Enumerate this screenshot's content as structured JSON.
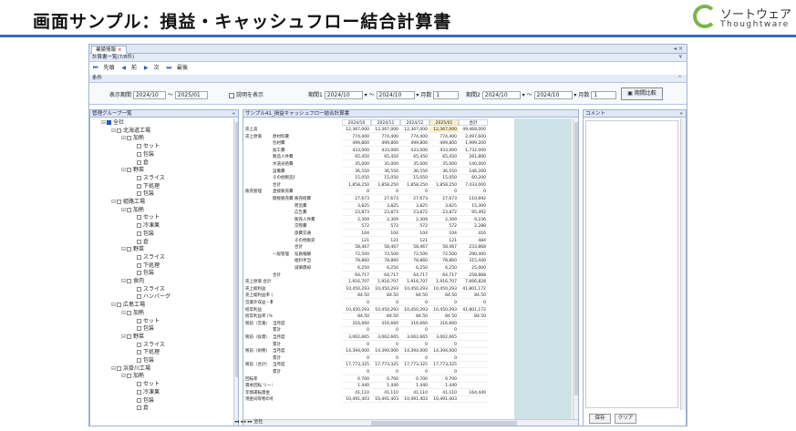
{
  "slide": {
    "title": "画面サンプル：損益・キャッシュフロー結合計算書",
    "logo_jp": "ソートウェア",
    "logo_en": "Thoughtware"
  },
  "app": {
    "tab_label": "業績情報",
    "list_bar": "計算書一覧(7/8件)",
    "pager": {
      "first": "先頭",
      "prev": "前",
      "next": "次",
      "last": "最後"
    },
    "condition_bar": "条件",
    "filter": {
      "period_label": "表示期間",
      "period_from": "2024/10",
      "tilde": "～",
      "period_to": "2025/01",
      "show_desc_label": "説明を表示",
      "p1_label": "期間1",
      "p1_from": "2024/10",
      "p1_to": "2024/10",
      "p1_months_label": "月数",
      "p1_months": "1",
      "p2_label": "期間2",
      "p2_from": "2024/10",
      "p2_to": "2024/10",
      "p2_months_label": "月数",
      "p2_months": "1",
      "compare_button": "期間比較"
    },
    "left_panel_title": "管理グループ一覧",
    "center_panel_title": "サンプル41_損益キャッシュフロー結合計算書",
    "right_panel_title": "コメント",
    "save_button": "保存",
    "clear_button": "クリア",
    "sheet_tab": "全社"
  },
  "tree": [
    {
      "label": "全社",
      "level": 0,
      "checked": true
    },
    {
      "label": "北海道工場",
      "level": 1
    },
    {
      "label": "加熱",
      "level": 2
    },
    {
      "label": "セット",
      "level": 3
    },
    {
      "label": "包装",
      "level": 3
    },
    {
      "label": "倉",
      "level": 3
    },
    {
      "label": "野菜",
      "level": 2
    },
    {
      "label": "スライス",
      "level": 3
    },
    {
      "label": "下処理",
      "level": 3
    },
    {
      "label": "包装",
      "level": 3
    },
    {
      "label": "姫路工場",
      "level": 1
    },
    {
      "label": "加熱",
      "level": 2
    },
    {
      "label": "セット",
      "level": 3
    },
    {
      "label": "冷凍果",
      "level": 3
    },
    {
      "label": "包装",
      "level": 3
    },
    {
      "label": "倉",
      "level": 3
    },
    {
      "label": "野菜",
      "level": 2
    },
    {
      "label": "スライス",
      "level": 3
    },
    {
      "label": "下処理",
      "level": 3
    },
    {
      "label": "包装",
      "level": 3
    },
    {
      "label": "食肉",
      "level": 2
    },
    {
      "label": "スライス",
      "level": 3
    },
    {
      "label": "ハンバーグ",
      "level": 3
    },
    {
      "label": "広島工場",
      "level": 1
    },
    {
      "label": "加熱",
      "level": 2
    },
    {
      "label": "セット",
      "level": 3
    },
    {
      "label": "包装",
      "level": 3
    },
    {
      "label": "野菜",
      "level": 2
    },
    {
      "label": "スライス",
      "level": 3
    },
    {
      "label": "下処理",
      "level": 3
    },
    {
      "label": "包装",
      "level": 3
    },
    {
      "label": "浜掛川工場",
      "level": 1
    },
    {
      "label": "加熱",
      "level": 2
    },
    {
      "label": "セット",
      "level": 3
    },
    {
      "label": "冷凍果",
      "level": 3
    },
    {
      "label": "包装",
      "level": 3
    },
    {
      "label": "倉",
      "level": 3
    }
  ],
  "table": {
    "columns": [
      "2024/10",
      "2024/11",
      "2024/12",
      "2025/01",
      "合計"
    ],
    "highlight_col": 3,
    "rows": [
      [
        "売上高",
        "",
        "",
        "12,367,000",
        "12,367,000",
        "12,367,000",
        "12,367,000",
        "49,468,000"
      ],
      [
        "売上原価",
        "原材料費",
        "",
        "774,400",
        "774,400",
        "774,400",
        "774,400",
        "2,097,600"
      ],
      [
        "",
        "包材費",
        "",
        "499,800",
        "499,800",
        "499,800",
        "499,800",
        "1,999,200"
      ],
      [
        "",
        "加工費",
        "",
        "433,000",
        "433,000",
        "433,000",
        "433,000",
        "1,732,000"
      ],
      [
        "",
        "製造人件費",
        "",
        "65,450",
        "65,450",
        "65,450",
        "65,450",
        "261,800"
      ],
      [
        "",
        "水道光熱費",
        "",
        "35,000",
        "35,000",
        "35,000",
        "35,000",
        "140,000"
      ],
      [
        "",
        "設備費",
        "",
        "36,550",
        "36,550",
        "36,550",
        "36,550",
        "146,200"
      ],
      [
        "",
        "その他製造費",
        "",
        "15,050",
        "15,050",
        "15,050",
        "15,050",
        "60,200"
      ],
      [
        "",
        "合計",
        "",
        "1,858,250",
        "1,858,250",
        "1,858,250",
        "1,858,250",
        "7,433,000"
      ],
      [
        "販売管理",
        "直接販売費",
        "",
        "0",
        "0",
        "0",
        "0",
        "0"
      ],
      [
        "",
        "間接販売費",
        "販売経費",
        "27,673",
        "27,673",
        "27,673",
        "27,673",
        "110,692"
      ],
      [
        "",
        "",
        "荷造費",
        "3,825",
        "3,825",
        "3,825",
        "3,825",
        "15,300"
      ],
      [
        "",
        "",
        "広告費",
        "23,873",
        "23,873",
        "23,872",
        "23,872",
        "95,492"
      ],
      [
        "",
        "",
        "販売人件費",
        "2,309",
        "2,309",
        "2,309",
        "2,309",
        "9,236"
      ],
      [
        "",
        "",
        "交際費",
        "572",
        "572",
        "572",
        "572",
        "2,288"
      ],
      [
        "",
        "",
        "旅費交通",
        "104",
        "104",
        "104",
        "104",
        "416"
      ],
      [
        "",
        "",
        "その他販売費",
        "121",
        "121",
        "121",
        "121",
        "484"
      ],
      [
        "",
        "",
        "合計",
        "58,467",
        "58,467",
        "58,467",
        "58,467",
        "233,868"
      ],
      [
        "",
        "一般管理",
        "役員報酬",
        "72,500",
        "72,500",
        "72,500",
        "72,500",
        "290,400"
      ],
      [
        "",
        "",
        "給料手当",
        "78,860",
        "78,860",
        "78,860",
        "78,860",
        "315,440"
      ],
      [
        "",
        "",
        "減価償却",
        "6,250",
        "6,250",
        "6,250",
        "6,250",
        "25,000"
      ],
      [
        "",
        "合計",
        "",
        "64,717",
        "64,717",
        "64,717",
        "64,717",
        "258,868"
      ],
      [
        "売上原価 合計",
        "",
        "",
        "1,916,707",
        "1,916,707",
        "1,916,707",
        "1,916,707",
        "7,666,828"
      ],
      [
        "売上総利益",
        "",
        "",
        "10,450,293",
        "10,450,293",
        "10,450,293",
        "10,450,293",
        "41,801,172"
      ],
      [
        "売上総利益率 (%)",
        "",
        "",
        "84.50",
        "84.50",
        "84.50",
        "84.50",
        "84.50"
      ],
      [
        "営業外収益・費用",
        "",
        "",
        "0",
        "0",
        "0",
        "0",
        "0"
      ],
      [
        "経常利益",
        "",
        "",
        "10,450,293",
        "10,450,293",
        "10,450,293",
        "10,450,293",
        "41,801,172"
      ],
      [
        "経常利益率 (%)",
        "",
        "",
        "84.50",
        "84.50",
        "84.50",
        "84.50",
        "84.50"
      ],
      [
        "税前（営業）",
        "当月度",
        "",
        "316,660",
        "316,660",
        "316,660",
        "316,660",
        ""
      ],
      [
        "",
        "累計",
        "",
        "0",
        "0",
        "0",
        "0",
        ""
      ],
      [
        "税前（投資）",
        "当月度",
        "",
        "3,062,665",
        "3,062,665",
        "3,062,665",
        "3,062,665",
        ""
      ],
      [
        "",
        "累計",
        "",
        "0",
        "0",
        "0",
        "0",
        ""
      ],
      [
        "税前（財務）",
        "当月度",
        "",
        "14,394,000",
        "14,394,000",
        "14,394,000",
        "14,394,000",
        ""
      ],
      [
        "",
        "累計",
        "",
        "0",
        "0",
        "0",
        "0",
        ""
      ],
      [
        "税前（合計）",
        "当月度",
        "",
        "17,773,325",
        "17,773,325",
        "17,773,325",
        "17,773,325",
        ""
      ],
      [
        "",
        "累計",
        "",
        "0",
        "0",
        "0",
        "0",
        ""
      ],
      [
        "回転率",
        "",
        "",
        "0.700",
        "0.700",
        "0.700",
        "0.700",
        ""
      ],
      [
        "資本回転 リードタイム",
        "",
        "",
        "1.440",
        "1.440",
        "1.440",
        "1.440",
        ""
      ],
      [
        "年間運転資金",
        "",
        "",
        "41,110",
        "41,110",
        "41,110",
        "41,110",
        "164,440"
      ],
      [
        "現金同等物の増加",
        "",
        "",
        "10,491,403",
        "10,491,403",
        "10,491,403",
        "10,491,403",
        ""
      ]
    ]
  }
}
